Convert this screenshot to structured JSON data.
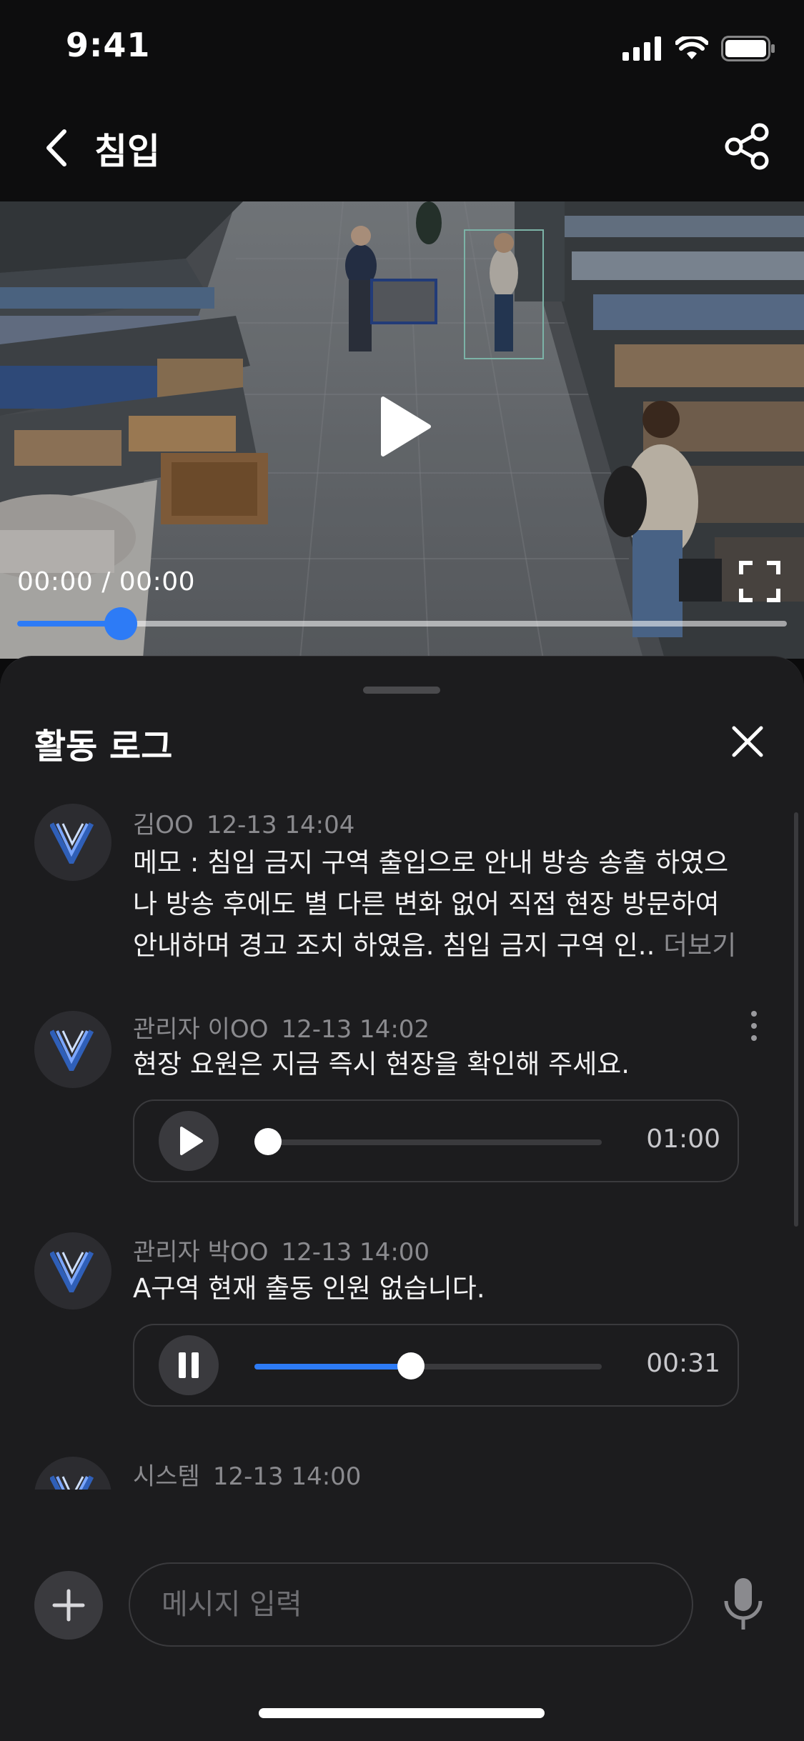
{
  "status_bar": {
    "time": "9:41"
  },
  "header": {
    "title": "침입"
  },
  "video": {
    "time_display": "00:00 / 00:00",
    "progress": 0.135
  },
  "activity_log": {
    "title": "활동 로그",
    "entries": [
      {
        "author": "김OO",
        "timestamp": "12-13 14:04",
        "text": "메모 : 침입 금지 구역 출입으로 안내 방송 송출 하였으나 방송 후에도 별 다른 변화 없어 직접 현장 방문하여 안내하며 경고 조치 하였음. 침입 금지 구역 인..",
        "more_label": "더보기"
      },
      {
        "author": "관리자 이OO",
        "timestamp": "12-13 14:02",
        "text": "현장 요원은 지금 즉시 현장을 확인해 주세요.",
        "audio": {
          "state": "paused",
          "progress": 0.0,
          "duration": "01:00"
        }
      },
      {
        "author": "관리자 박OO",
        "timestamp": "12-13 14:00",
        "text": "A구역 현재 출동 인원 없습니다.",
        "audio": {
          "state": "playing",
          "progress": 0.45,
          "duration": "00:31"
        }
      },
      {
        "author": "시스템",
        "timestamp": "12-13 14:00"
      }
    ]
  },
  "composer": {
    "placeholder": "메시지 입력"
  },
  "colors": {
    "accent": "#2d7bf6",
    "sheet": "#1c1c1e",
    "background": "#0d0d0e"
  }
}
